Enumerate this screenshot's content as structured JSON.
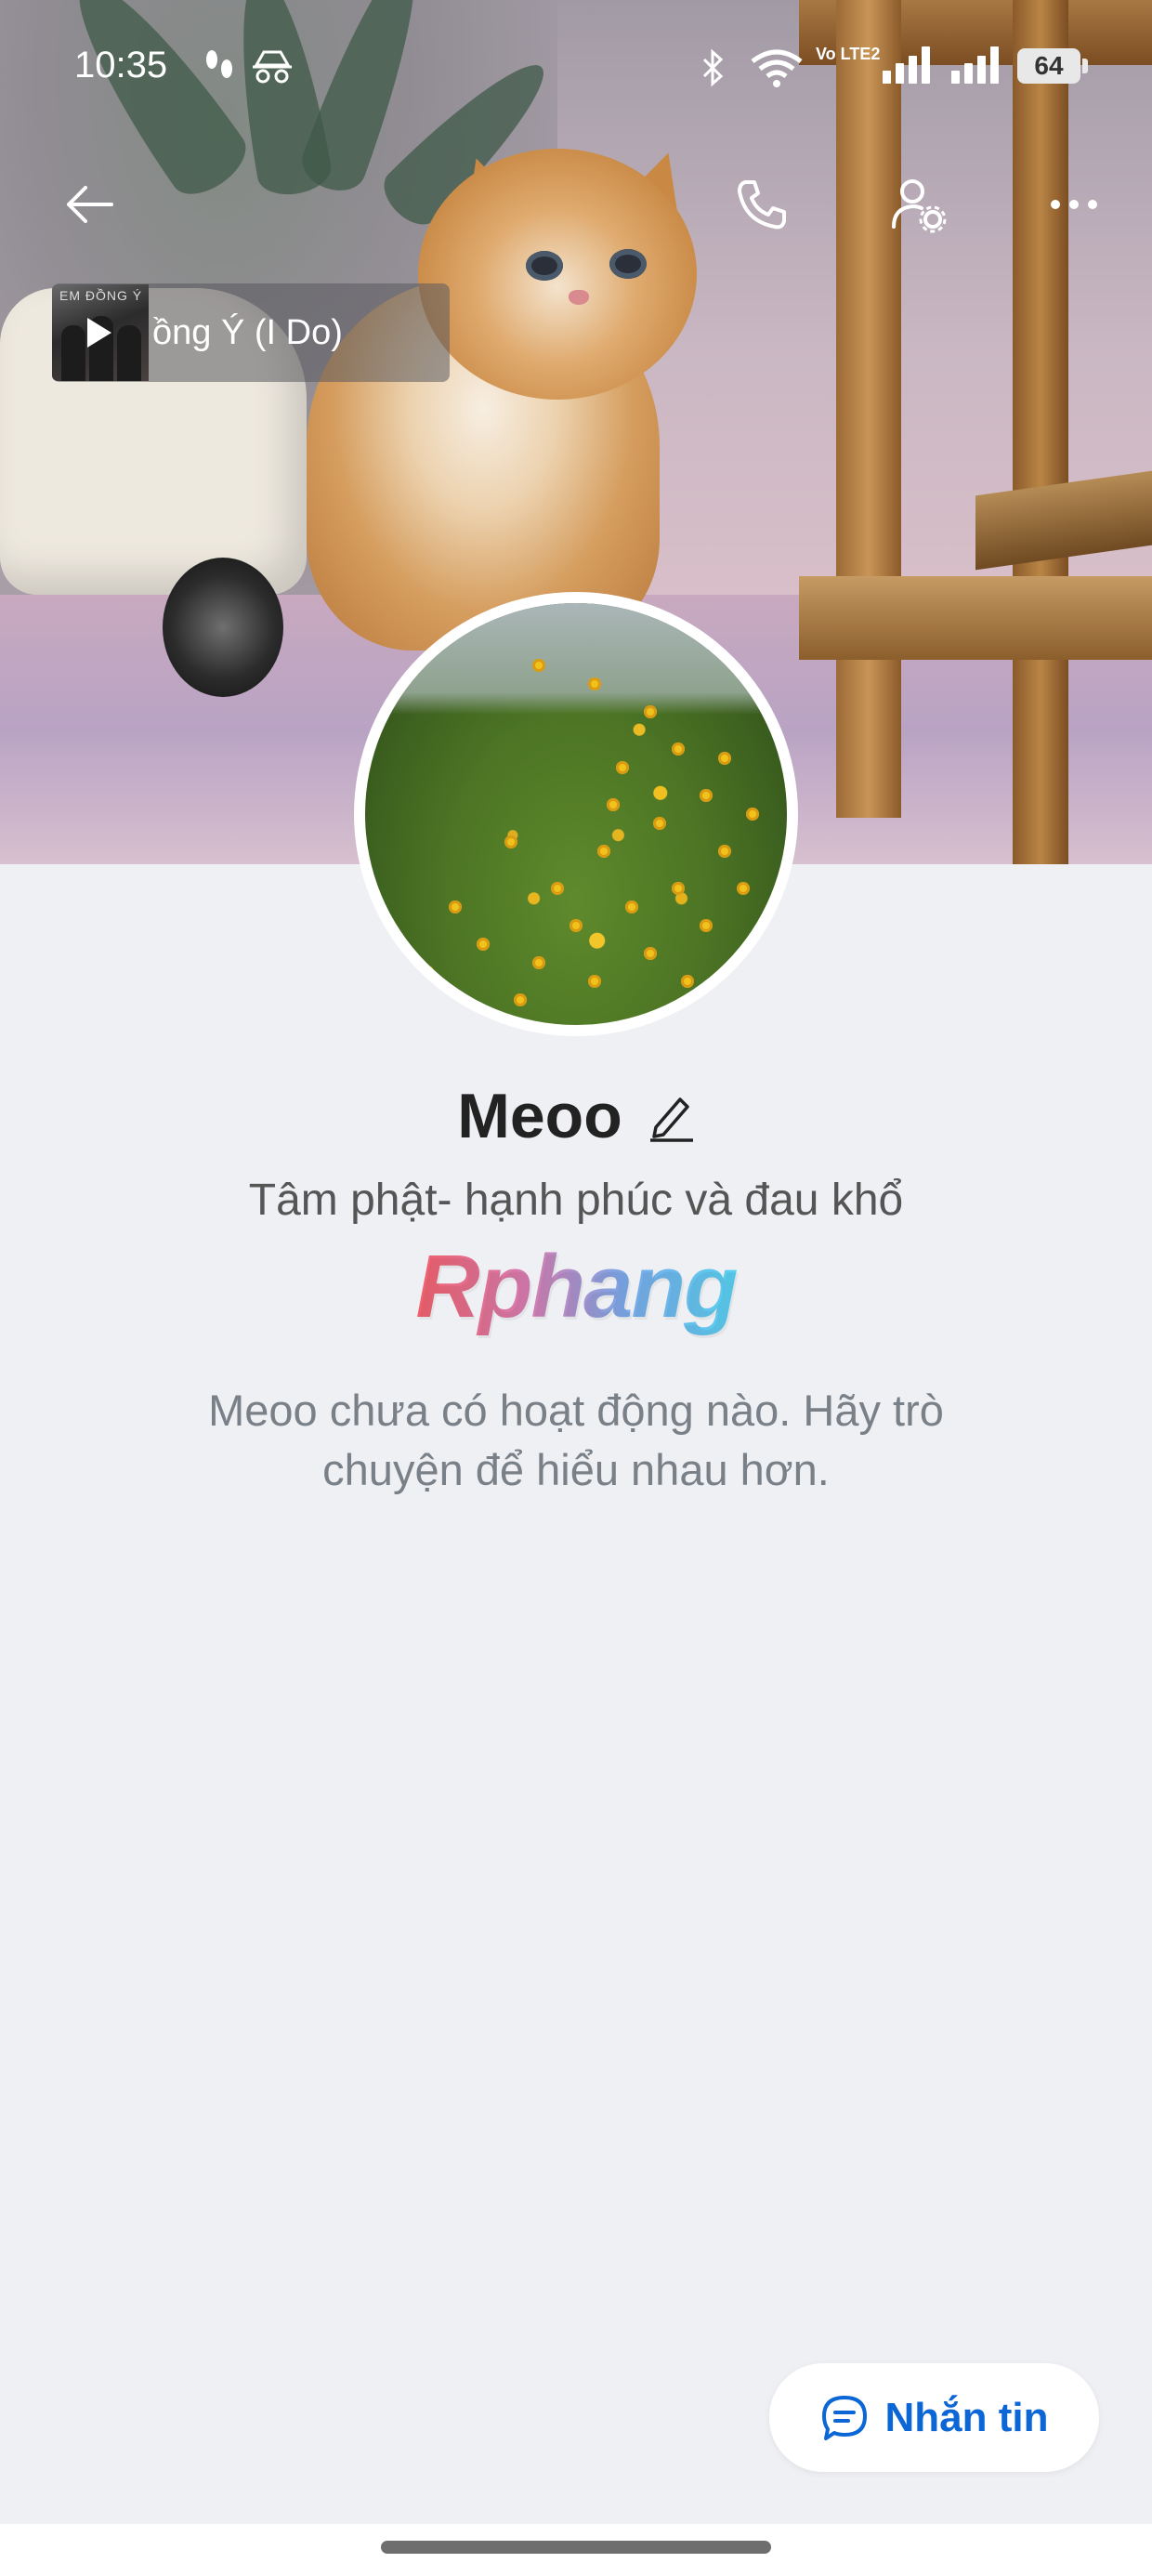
{
  "status_bar": {
    "time": "10:35",
    "network": "Vo LTE2",
    "battery": "64"
  },
  "nav": {
    "back_icon": "arrow-left-icon",
    "call_icon": "phone-icon",
    "settings_icon": "user-settings-icon",
    "more_icon": "more-horizontal-icon"
  },
  "music": {
    "thumb_text": "EM ĐỒNG Ý",
    "title": "ồng Ý (I Do)"
  },
  "profile": {
    "name": "Meoo",
    "bio": "Tâm phật- hạnh phúc và đau khổ",
    "badge": "Rphang",
    "empty_message": "Meoo chưa có hoạt động nào. Hãy trò chuyện để hiểu nhau hơn."
  },
  "actions": {
    "message_label": "Nhắn tin",
    "message_icon": "chat-bubble-icon"
  },
  "colors": {
    "accent": "#0b66d6",
    "background": "#eff0f4"
  }
}
